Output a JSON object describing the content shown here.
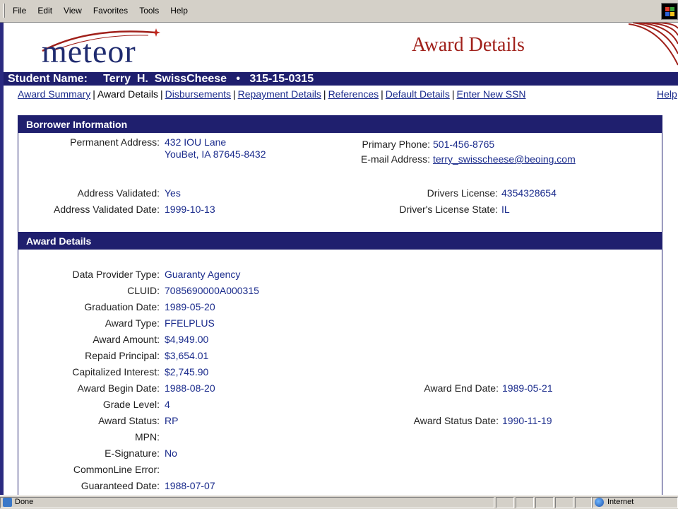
{
  "menu": [
    "File",
    "Edit",
    "View",
    "Favorites",
    "Tools",
    "Help"
  ],
  "header": {
    "logo": "meteor",
    "title": "Award Details"
  },
  "student": {
    "label": "Student Name:",
    "name": "Terry  H.  SwissCheese",
    "bullet": "•",
    "ssn": "315-15-0315"
  },
  "nav": {
    "award_summary": "Award Summary",
    "award_details": "Award Details",
    "disbursements": "Disbursements",
    "repayment_details": "Repayment Details",
    "references": "References",
    "default_details": "Default Details",
    "enter_new_ssn": "Enter New SSN",
    "help": "Help",
    "sep": "|"
  },
  "borrower": {
    "heading": "Borrower Information",
    "permanent_address_label": "Permanent Address:",
    "address_line1": "432 IOU Lane",
    "address_line2": "YouBet, IA 87645-8432",
    "primary_phone_label": "Primary Phone:",
    "primary_phone": "501-456-8765",
    "email_label": "E-mail Address:",
    "email": "terry_swisscheese@beoing.com",
    "address_validated_label": "Address Validated:",
    "address_validated": "Yes",
    "address_validated_date_label": "Address Validated Date:",
    "address_validated_date": "1999-10-13",
    "drivers_license_label": "Drivers License:",
    "drivers_license": "4354328654",
    "drivers_license_state_label": "Driver's License State:",
    "drivers_license_state": "IL"
  },
  "award": {
    "heading": "Award Details",
    "fields": [
      {
        "label": "Data Provider Type:",
        "value": "Guaranty Agency"
      },
      {
        "label": "CLUID:",
        "value": "7085690000A000315"
      },
      {
        "label": "Graduation Date:",
        "value": "1989-05-20"
      },
      {
        "label": "Award Type:",
        "value": "FFELPLUS"
      },
      {
        "label": "Award Amount:",
        "value": "$4,949.00"
      },
      {
        "label": "Repaid Principal:",
        "value": "$3,654.01"
      },
      {
        "label": "Capitalized Interest:",
        "value": "$2,745.90"
      },
      {
        "label": "Award Begin Date:",
        "value": "1988-08-20"
      },
      {
        "label": "Grade Level:",
        "value": "4"
      },
      {
        "label": "Award Status:",
        "value": "RP"
      },
      {
        "label": "MPN:",
        "value": ""
      },
      {
        "label": "E-Signature:",
        "value": "No"
      },
      {
        "label": "CommonLine Error:",
        "value": ""
      },
      {
        "label": "Guaranteed Date:",
        "value": "1988-07-07"
      }
    ],
    "award_end_date_label": "Award End Date:",
    "award_end_date": "1989-05-21",
    "award_status_date_label": "Award Status Date:",
    "award_status_date": "1990-11-19"
  },
  "status": {
    "left": "Done",
    "zone": "Internet"
  },
  "colors": {
    "navy": "#1f1f6e",
    "value_blue": "#1a2b8c",
    "title_red": "#a0201a"
  }
}
